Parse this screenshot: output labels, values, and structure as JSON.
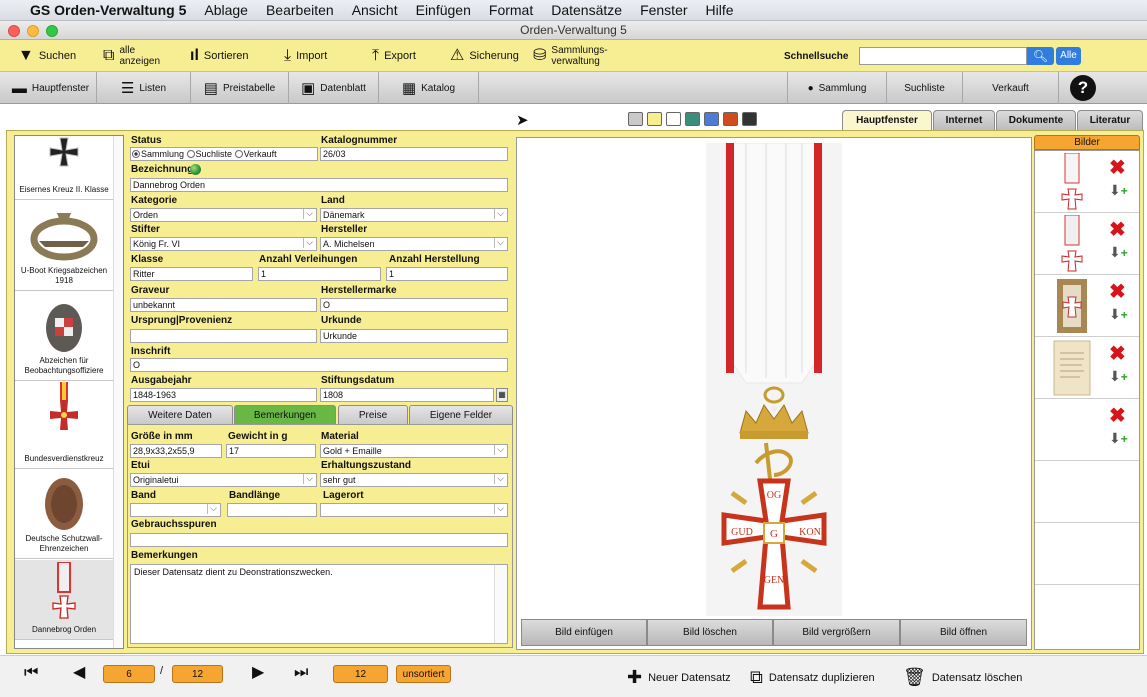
{
  "menubar": {
    "app": "GS Orden-Verwaltung 5",
    "items": [
      "Ablage",
      "Bearbeiten",
      "Ansicht",
      "Einfügen",
      "Format",
      "Datensätze",
      "Fenster",
      "Hilfe"
    ]
  },
  "window": {
    "title": "Orden-Verwaltung 5"
  },
  "toolbar": {
    "search": "Suchen",
    "show_all": "alle anzeigen",
    "sort": "Sortieren",
    "import": "Import",
    "export": "Export",
    "backup": "Sicherung",
    "collection_mgmt": "Sammlungs- verwaltung",
    "quicksearch_label": "Schnellsuche",
    "quicksearch_value": "",
    "all_button": "Alle"
  },
  "navbar": {
    "main": "Hauptfenster",
    "lists": "Listen",
    "pricetable": "Preistabelle",
    "datasheet": "Datenblatt",
    "catalog": "Katalog",
    "collection": "Sammlung",
    "searchlist": "Suchliste",
    "sale": "Verkauft",
    "help": "?"
  },
  "colors": [
    "#c9c9c9",
    "#f8ee8e",
    "#ffffff",
    "#3c8d7a",
    "#4f7bd6",
    "#d24b1c",
    "#333333"
  ],
  "right_tabs": [
    "Hauptfenster",
    "Internet",
    "Dokumente",
    "Literatur"
  ],
  "list_items": [
    "Eisernes Kreuz II. Klasse",
    "U-Boot Kriegsabzeichen 1918",
    "Abzeichen für Beobachtungsoffiziere",
    "Bundesverdienstkreuz",
    "Deutsche Schutzwall-Ehrenzeichen",
    "Dannebrog Orden"
  ],
  "form": {
    "status_label": "Status",
    "status_options": [
      "Sammlung",
      "Suchliste",
      "Verkauft"
    ],
    "catalog_no_label": "Katalognummer",
    "catalog_no": "26/03",
    "name_label": "Bezeichnung",
    "name": "Dannebrog Orden",
    "category_label": "Kategorie",
    "category": "Orden",
    "country_label": "Land",
    "country": "Dänemark",
    "founder_label": "Stifter",
    "founder": "König Fr. VI",
    "maker_label": "Hersteller",
    "maker": "A. Michelsen",
    "class_label": "Klasse",
    "class": "Ritter",
    "awards_label": "Anzahl Verleihungen",
    "awards": "1",
    "production_label": "Anzahl Herstellung",
    "production": "1",
    "engraver_label": "Graveur",
    "engraver": "unbekannt",
    "makermark_label": "Herstellermarke",
    "makermark": "O",
    "origin_label": "Ursprung|Provenienz",
    "origin": "",
    "certificate_label": "Urkunde",
    "certificate": "Urkunde",
    "inscription_label": "Inschrift",
    "inscription": "O",
    "issue_year_label": "Ausgabejahr",
    "issue_year": "1848-1963",
    "founding_date_label": "Stiftungsdatum",
    "founding_date": "1808"
  },
  "subtabs": [
    "Weitere Daten",
    "Bemerkungen",
    "Preise",
    "Eigene Felder"
  ],
  "sub": {
    "size_label": "Größe in mm",
    "size": "28,9x33,2x55,9",
    "weight_label": "Gewicht in g",
    "weight": "17",
    "material_label": "Material",
    "material": "Gold + Emaille",
    "case_label": "Etui",
    "case": "Originaletui",
    "condition_label": "Erhaltungszustand",
    "condition": "sehr gut",
    "ribbon_label": "Band",
    "ribbon": "",
    "ribbon_len_label": "Bandlänge",
    "ribbon_len": "",
    "storage_label": "Lagerort",
    "storage": "",
    "wear_label": "Gebrauchsspuren",
    "wear": "",
    "remarks_label": "Bemerkungen",
    "remarks": "Dieser Datensatz dient zu Deonstrationszwecken."
  },
  "medal": {
    "top": "OG",
    "left": "GUD",
    "center": "G",
    "right": "KON",
    "bottom": "GEN"
  },
  "image_buttons": [
    "Bild einfügen",
    "Bild löschen",
    "Bild vergrößern",
    "Bild öffnen"
  ],
  "images_header": "Bilder",
  "bottom": {
    "current": "6",
    "sep": "/",
    "total": "12",
    "found": "12",
    "sorted": "unsortiert",
    "new": "Neuer Datensatz",
    "duplicate": "Datensatz duplizieren",
    "delete": "Datensatz löschen"
  }
}
